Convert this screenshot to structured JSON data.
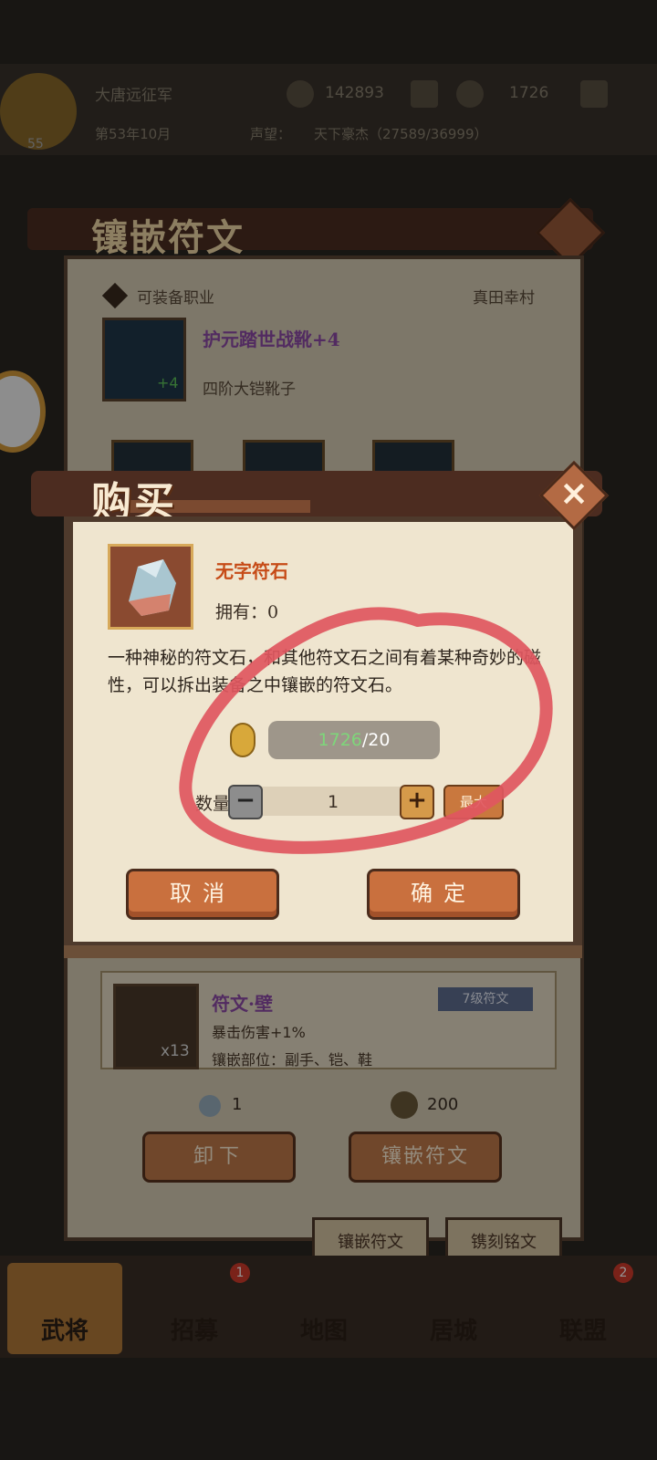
{
  "background": {
    "player_name": "大唐远征军",
    "player_level": "55",
    "date": "第53年10月",
    "reputation_label": "声望：",
    "reputation_value": "天下豪杰（27589/36999）",
    "currency_1": "142893",
    "currency_2": "1726",
    "page_title": "镶嵌符文",
    "job_label": "可装备职业",
    "job_value": "真田幸村",
    "equip_name": "护元踏世战靴+4",
    "equip_desc": "四阶大铠靴子",
    "equip_plus": "+4",
    "rune": {
      "name": "符文·壁",
      "level_badge": "7级符文",
      "effect": "暴击伤害+1%",
      "slots": "镶嵌部位：副手、铠、鞋",
      "count": "x13"
    },
    "cost_stone": "1",
    "cost_coin": "200",
    "unequip_button": "卸下",
    "inlay_button": "镶嵌符文",
    "tabs": [
      "镶嵌符文",
      "镌刻铭文"
    ],
    "nav": [
      {
        "label": "武将"
      },
      {
        "label": "招募",
        "badge": "1"
      },
      {
        "label": "地图"
      },
      {
        "label": "居城"
      },
      {
        "label": "联盟",
        "badge": "2"
      }
    ]
  },
  "dialog": {
    "title": "购买",
    "item_name": "无字符石",
    "owned_label": "拥有：0",
    "description": "一种神秘的符文石，和其他符文石之间有着某种奇妙的磁性，可以拆出装备之中镶嵌的符文石。",
    "price_have": "1726",
    "price_sep": "/",
    "price_cost": "20",
    "quantity_label": "数量",
    "quantity_value": "1",
    "minus_symbol": "−",
    "plus_symbol": "+",
    "max_label": "最大",
    "cancel_button": "取消",
    "confirm_button": "确定"
  },
  "colors": {
    "annotation": "#e0575f",
    "title_text": "#c64b17",
    "price_have": "#7ed67a"
  }
}
